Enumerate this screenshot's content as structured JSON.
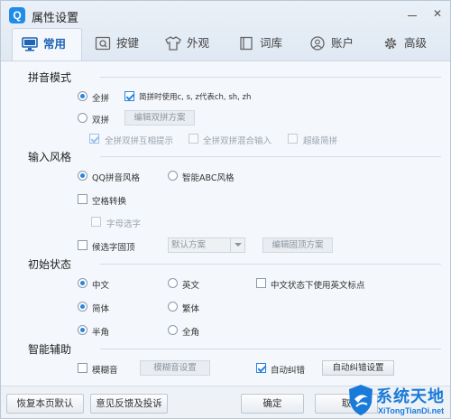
{
  "window": {
    "title": "属性设置",
    "logo_letter": "Q"
  },
  "tabs": [
    {
      "label": "常用",
      "icon": "monitor-icon"
    },
    {
      "label": "按键",
      "icon": "keyboard-key-icon"
    },
    {
      "label": "外观",
      "icon": "tshirt-icon"
    },
    {
      "label": "词库",
      "icon": "book-icon"
    },
    {
      "label": "账户",
      "icon": "user-icon"
    },
    {
      "label": "高级",
      "icon": "gear-icon"
    }
  ],
  "active_tab": "常用",
  "pinyin_mode": {
    "title": "拼音模式",
    "quanpin": {
      "label": "全拼",
      "selected": true
    },
    "shuangpin": {
      "label": "双拼",
      "selected": false
    },
    "jianpin": {
      "label": "简拼时使用c, s, z代表ch, sh, zh",
      "checked": true
    },
    "edit_shuangpin": "编辑双拼方案",
    "qp_sp_hint": {
      "label": "全拼双拼互相提示",
      "checked": true
    },
    "qp_sp_mixed": {
      "label": "全拼双拼混合输入",
      "checked": false
    },
    "super_jianpin": {
      "label": "超级简拼",
      "checked": false
    }
  },
  "input_style": {
    "title": "输入风格",
    "qq_style": {
      "label": "QQ拼音风格",
      "selected": true
    },
    "abc_style": {
      "label": "智能ABC风格",
      "selected": false
    },
    "space_convert": {
      "label": "空格转换",
      "checked": false
    },
    "letter_select": {
      "label": "字母选字",
      "checked": false
    },
    "fixed_candidate": {
      "label": "候选字固顶",
      "checked": false
    },
    "default_scheme": "默认方案",
    "edit_fixed": "编辑固顶方案"
  },
  "initial_state": {
    "title": "初始状态",
    "chinese": {
      "label": "中文",
      "selected": true
    },
    "english": {
      "label": "英文",
      "selected": false
    },
    "cn_use_en_punct": {
      "label": "中文状态下使用英文标点",
      "checked": false
    },
    "simplified": {
      "label": "简体",
      "selected": true
    },
    "traditional": {
      "label": "繁体",
      "selected": false
    },
    "halfwidth": {
      "label": "半角",
      "selected": true
    },
    "fullwidth": {
      "label": "全角",
      "selected": false
    }
  },
  "smart_assist": {
    "title": "智能辅助",
    "fuzzy": {
      "label": "模糊音",
      "checked": false
    },
    "fuzzy_settings": "模糊音设置",
    "auto_correct": {
      "label": "自动纠错",
      "checked": true
    },
    "auto_correct_settings": "自动纠错设置"
  },
  "footer": {
    "restore": "恢复本页默认",
    "feedback": "意见反馈及投诉",
    "ok": "确定",
    "cancel": "取"
  },
  "watermark": {
    "title": "系统天地",
    "sub": "XiTongTianDi.net"
  },
  "colors": {
    "accent": "#2c84dd",
    "active_tab": "#1e64b4",
    "watermark": "#1a7ad8"
  }
}
